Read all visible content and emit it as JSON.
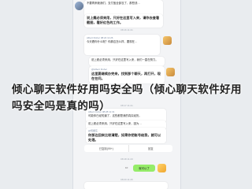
{
  "article": {
    "title": "倾心聊天软件好用吗安全吗（倾心聊天软件好用吗安全吗是真的吗）"
  },
  "chat": {
    "timestamps": [
      "08:16 11:21",
      "08:17 11:21",
      "08:18 11:23",
      "08:20 11:25"
    ],
    "messages": [
      {
        "meta": "",
        "body": "不要再来砸我们，支付宝全部没了，那些钱…",
        "time": ""
      },
      {
        "meta": "",
        "body": "说上瘾必须来用，只好在这里写入来，请你去查看截图，看好红色的工作。",
        "time": ""
      },
      {
        "meta": "Albert Fisher 08:24 11:26",
        "body": "今天看你什么呢？你那边怎么样，要现在…",
        "time": ""
      },
      {
        "meta": "",
        "body": "说上瘾必须来用，只好在这里写入来，我们一直在努力。",
        "time": ""
      },
      {
        "meta": "@Albert Fisher",
        "body": "这里要继续办完来，找到那个聊天，再打开，现在在问。",
        "time": ""
      },
      {
        "meta": "Albert Fisher 08:28 11:31",
        "body": "可能你已经知道了，这些都是我的真实经历。",
        "time": ""
      },
      {
        "meta": "",
        "body": "说上瘾必须来用，只好在这里写入来，因为…",
        "time": ""
      },
      {
        "meta": "@何振东",
        "body": "你那边回来比较清楚，如果你把账号给我，就可以处理。",
        "time": ""
      }
    ],
    "actions": [
      "已复制(99+)",
      "回复"
    ],
    "reply": "就可以了",
    "reply_badge": "10"
  }
}
